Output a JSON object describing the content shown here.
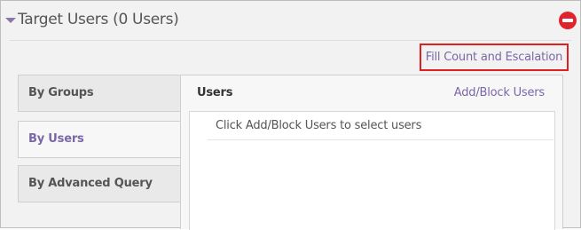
{
  "panel": {
    "title": "Target Users (0 Users)",
    "collapse_icon": "caret-down-icon",
    "remove_icon": "remove-circle-icon"
  },
  "toolbar": {
    "fill_count_label": "Fill Count and Escalation"
  },
  "tabs": [
    {
      "label": "By Groups",
      "selected": false
    },
    {
      "label": "By Users",
      "selected": true
    },
    {
      "label": "By Advanced Query",
      "selected": false
    }
  ],
  "content": {
    "title": "Users",
    "add_block_label": "Add/Block Users",
    "empty_message": "Click Add/Block Users to select users"
  },
  "colors": {
    "accent": "#7a67a8",
    "remove": "#e0242b",
    "highlight_border": "#e01f1f"
  }
}
